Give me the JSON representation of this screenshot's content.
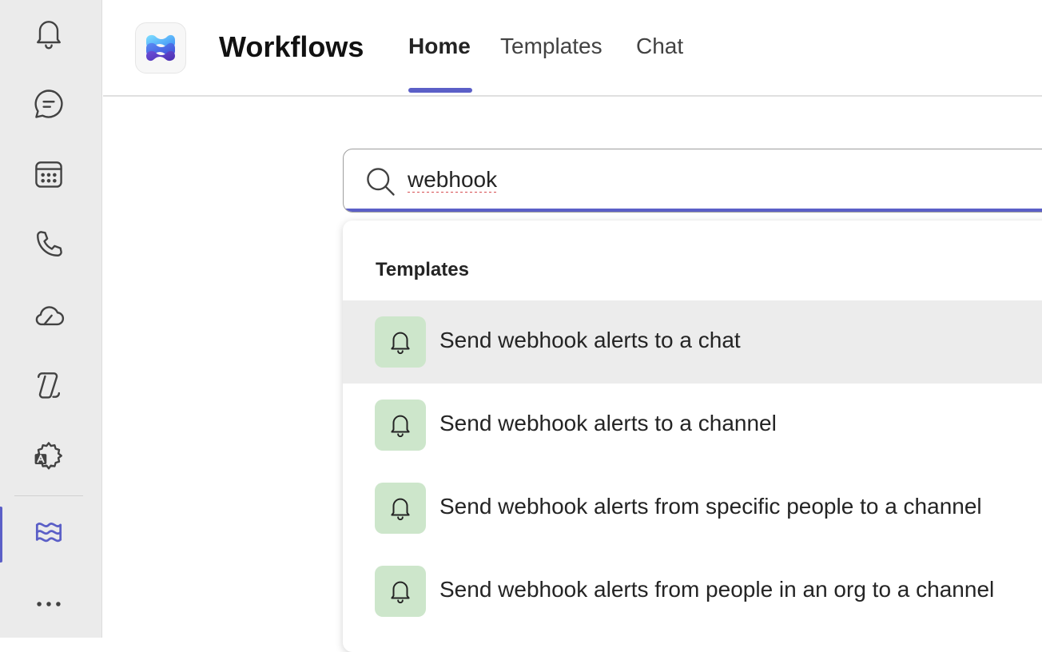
{
  "app": {
    "title": "Workflows"
  },
  "tabs": [
    {
      "label": "Home",
      "active": true
    },
    {
      "label": "Templates",
      "active": false
    },
    {
      "label": "Chat",
      "active": false
    }
  ],
  "rail": {
    "items": [
      {
        "icon": "bell-icon"
      },
      {
        "icon": "chat-icon"
      },
      {
        "icon": "calendar-icon"
      },
      {
        "icon": "phone-icon"
      },
      {
        "icon": "cloud-icon"
      },
      {
        "icon": "copilot-icon"
      },
      {
        "icon": "settings-translate-icon"
      },
      {
        "icon": "workflows-icon",
        "active": true
      },
      {
        "icon": "more-icon"
      }
    ]
  },
  "search": {
    "value": "webhook"
  },
  "dropdown": {
    "heading": "Templates",
    "items": [
      {
        "label": "Send webhook alerts to a chat",
        "icon": "bell-icon"
      },
      {
        "label": "Send webhook alerts to a channel",
        "icon": "bell-icon"
      },
      {
        "label": "Send webhook alerts from specific people to a channel",
        "icon": "bell-icon"
      },
      {
        "label": "Send webhook alerts from people in an org to a channel",
        "icon": "bell-icon"
      }
    ]
  },
  "colors": {
    "accent": "#5b5fc7",
    "rail_bg": "#ebebeb",
    "template_icon_bg": "#cde6cb",
    "hover_bg": "#ececec"
  }
}
